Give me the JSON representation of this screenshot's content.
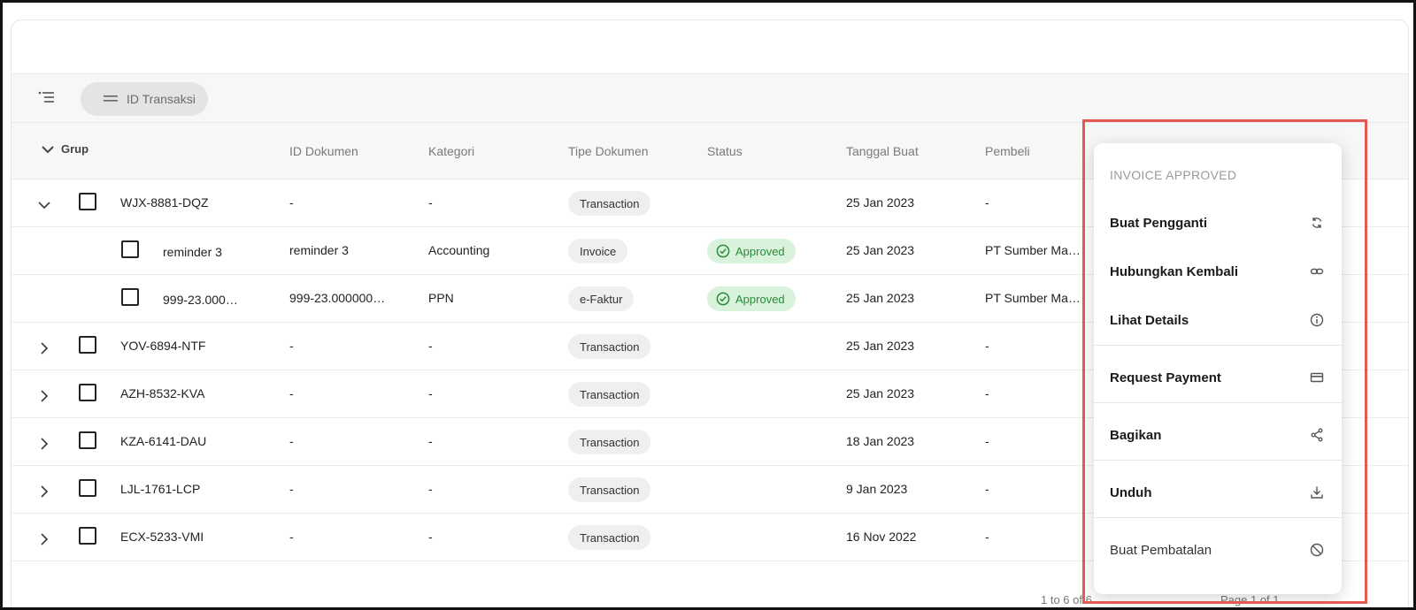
{
  "toolbar": {
    "chip_label": "ID Transaksi"
  },
  "table": {
    "group_label": "Grup",
    "headers": [
      "ID Dokumen",
      "Kategori",
      "Tipe Dokumen",
      "Status",
      "Tanggal Buat",
      "Pembeli"
    ],
    "rows": [
      {
        "expanded": true,
        "name": "WJX-8881-DQZ",
        "id_dokumen": "-",
        "kategori": "-",
        "tipe": "Transaction",
        "status": "",
        "tanggal": "25 Jan 2023",
        "pembeli": "-"
      },
      {
        "child": true,
        "name": "reminder 3",
        "id_dokumen": "reminder 3",
        "kategori": "Accounting",
        "tipe": "Invoice",
        "status": "Approved",
        "tanggal": "25 Jan 2023",
        "pembeli": "PT Sumber Ma…"
      },
      {
        "child": true,
        "name": "999-23.000…",
        "id_dokumen": "999-23.000000…",
        "kategori": "PPN",
        "tipe": "e-Faktur",
        "status": "Approved",
        "tanggal": "25 Jan 2023",
        "pembeli": "PT Sumber Ma…"
      },
      {
        "name": "YOV-6894-NTF",
        "id_dokumen": "-",
        "kategori": "-",
        "tipe": "Transaction",
        "status": "",
        "tanggal": "25 Jan 2023",
        "pembeli": "-"
      },
      {
        "name": "AZH-8532-KVA",
        "id_dokumen": "-",
        "kategori": "-",
        "tipe": "Transaction",
        "status": "",
        "tanggal": "25 Jan 2023",
        "pembeli": "-"
      },
      {
        "name": "KZA-6141-DAU",
        "id_dokumen": "-",
        "kategori": "-",
        "tipe": "Transaction",
        "status": "",
        "tanggal": "18 Jan 2023",
        "pembeli": "-"
      },
      {
        "name": "LJL-1761-LCP",
        "id_dokumen": "-",
        "kategori": "-",
        "tipe": "Transaction",
        "status": "",
        "tanggal": "9 Jan 2023",
        "pembeli": "-"
      },
      {
        "name": "ECX-5233-VMI",
        "id_dokumen": "-",
        "kategori": "-",
        "tipe": "Transaction",
        "status": "",
        "tanggal": "16 Nov 2022",
        "pembeli": "-"
      }
    ]
  },
  "pagination": {
    "range": "1 to 6 of 6",
    "page": "Page 1 of 1"
  },
  "context_menu": {
    "title": "INVOICE APPROVED",
    "items": [
      {
        "label": "Buat Pengganti",
        "icon": "refresh-icon"
      },
      {
        "label": "Hubungkan Kembali",
        "icon": "link-icon"
      },
      {
        "label": "Lihat Details",
        "icon": "info-icon"
      },
      {
        "label": "Request Payment",
        "icon": "card-icon"
      },
      {
        "label": "Bagikan",
        "icon": "share-icon"
      },
      {
        "label": "Unduh",
        "icon": "download-icon"
      },
      {
        "label": "Buat Pembatalan",
        "icon": "cancel-icon"
      }
    ]
  },
  "colors": {
    "approved_bg": "#d9f2dc",
    "approved_text": "#2a8a3a",
    "highlight": "#e25a52"
  }
}
